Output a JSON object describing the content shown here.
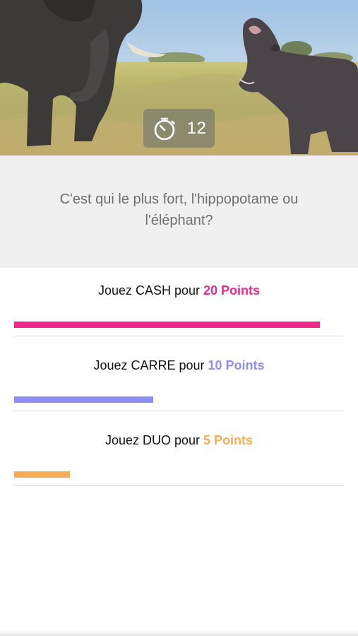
{
  "timer": {
    "icon": "stopwatch-icon",
    "value": "12"
  },
  "question": {
    "text": "C'est qui le plus fort, l'hippopotame ou l'éléphant?"
  },
  "options": [
    {
      "prefix": "Jouez CASH pour ",
      "points": "20 Points",
      "color": "#f0288c",
      "progress": 1.0
    },
    {
      "prefix": "Jouez CARRE pour ",
      "points": "10 Points",
      "color": "#8f8cf2",
      "progress": 0.455
    },
    {
      "prefix": "Jouez DUO pour ",
      "points": "5 Points",
      "color": "#f7ac56",
      "progress": 0.182
    }
  ]
}
